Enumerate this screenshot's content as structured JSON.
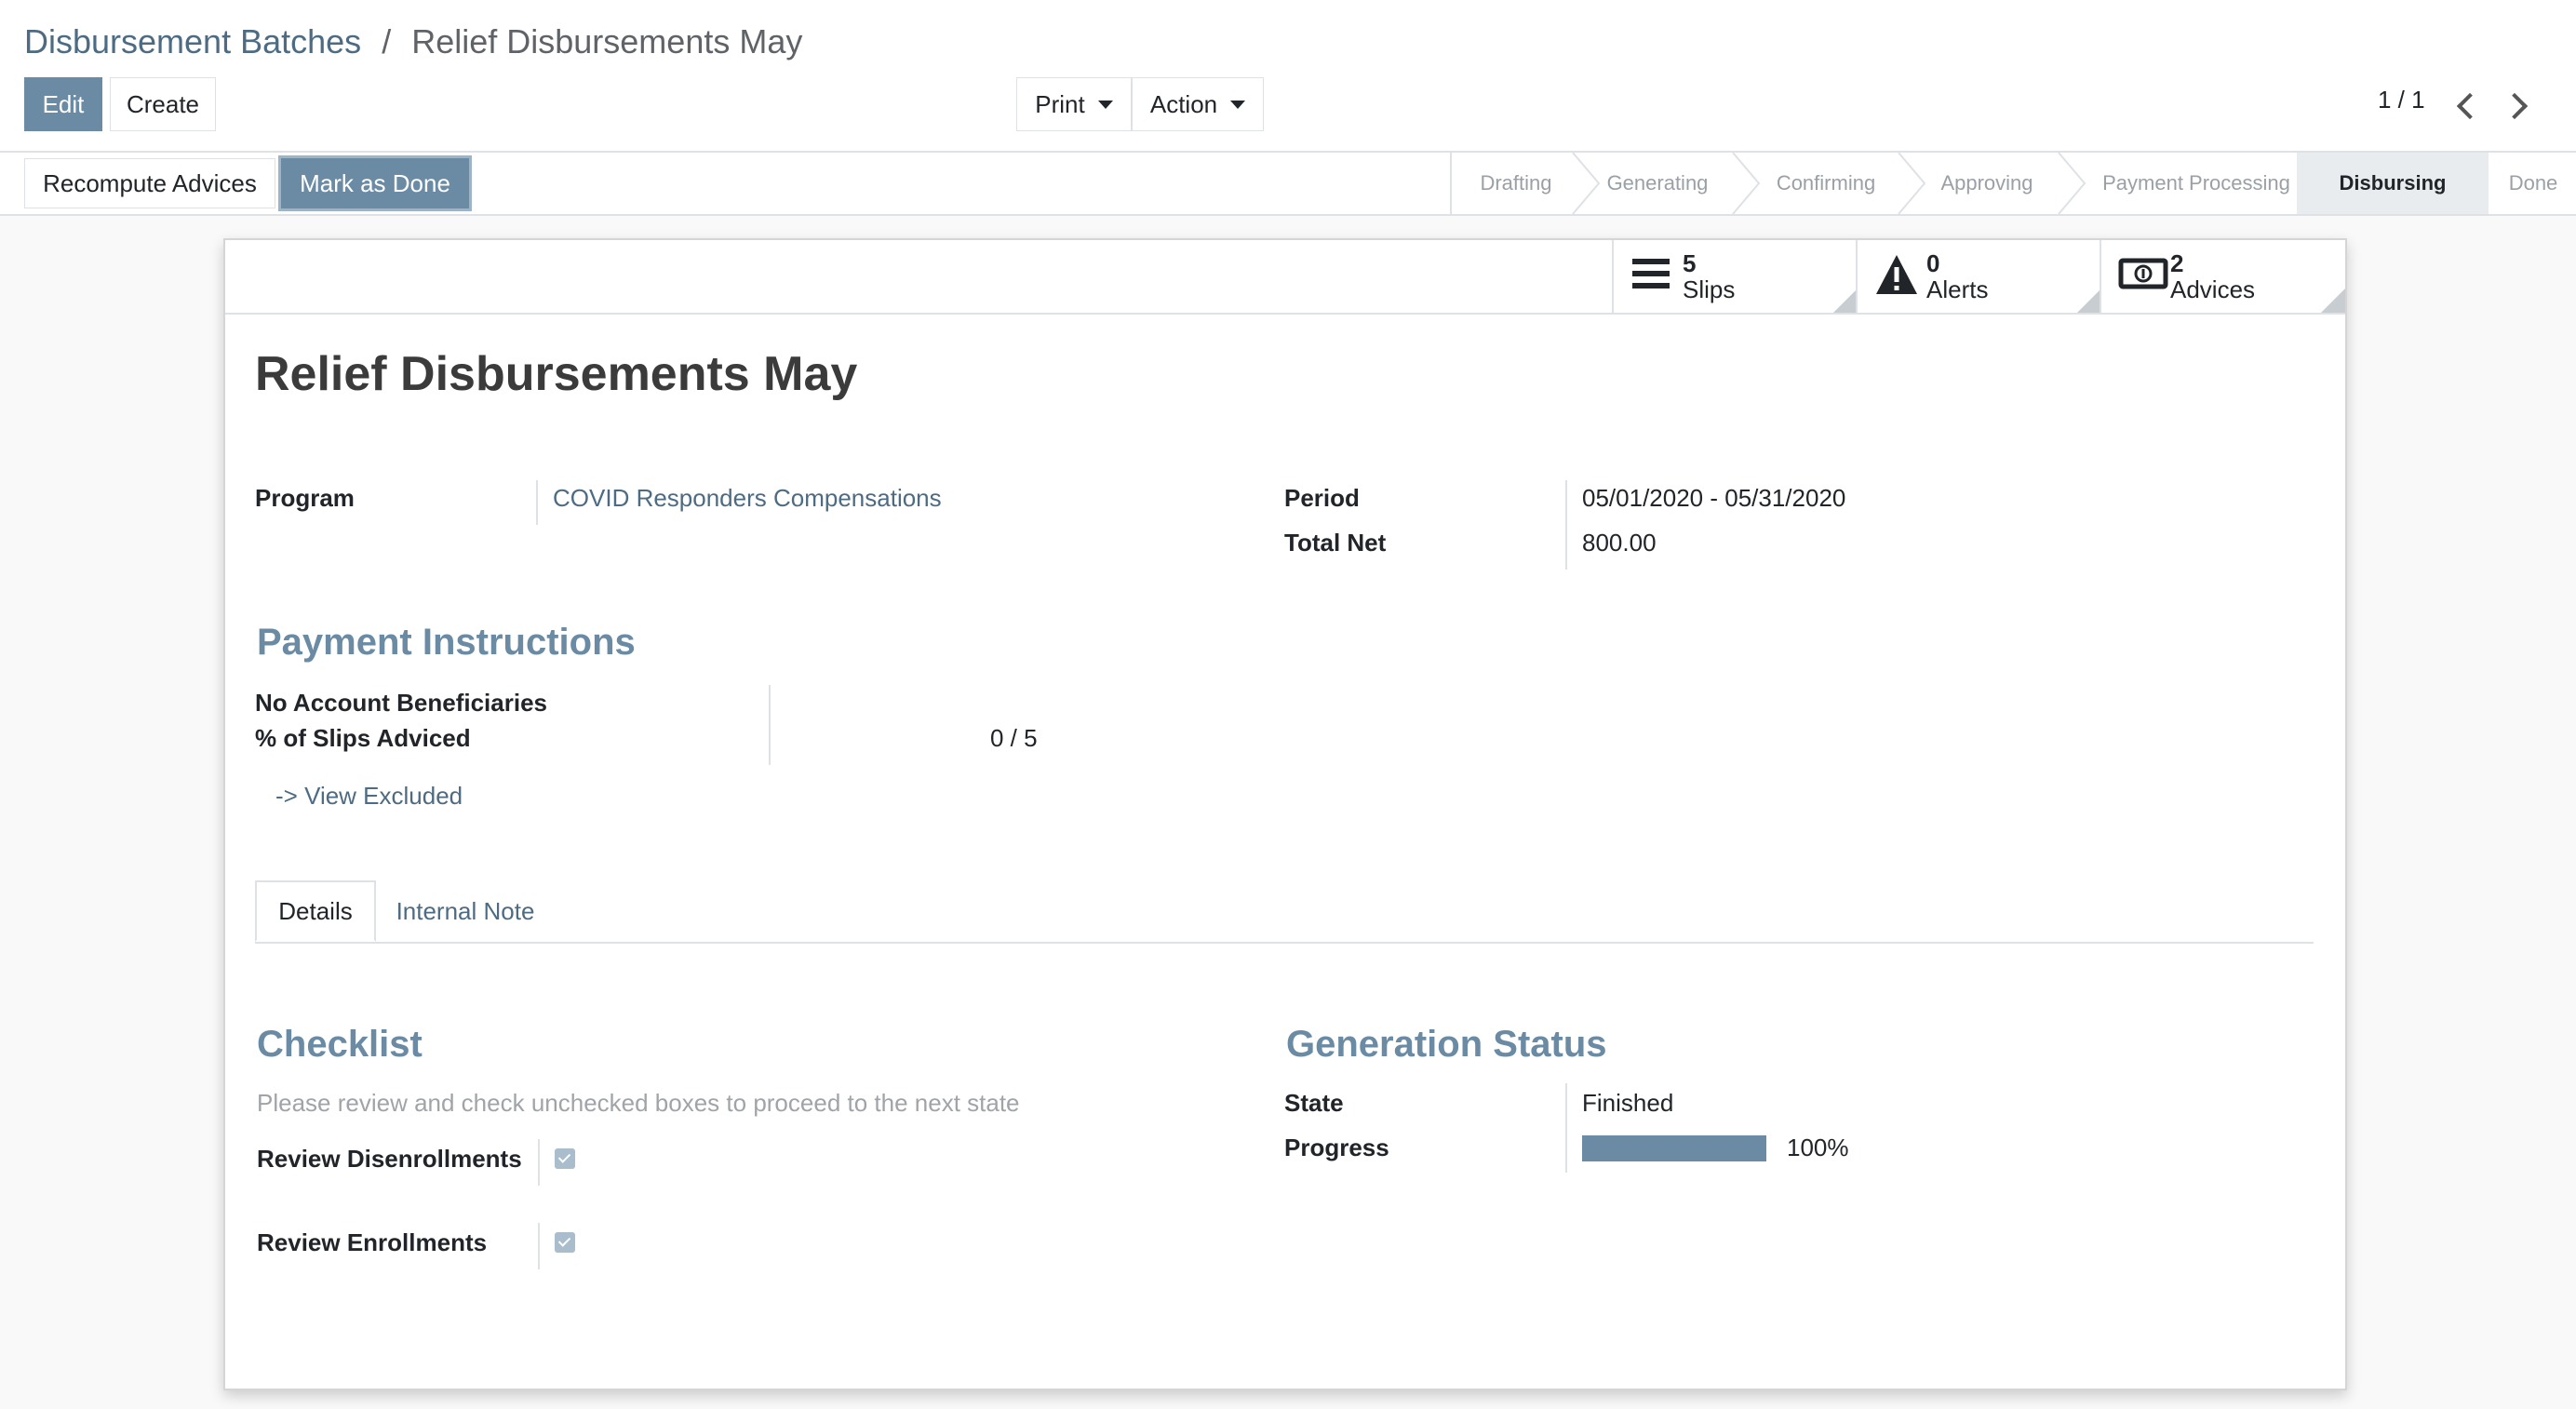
{
  "breadcrumb": {
    "parent": "Disbursement Batches",
    "separator": "/",
    "current": "Relief Disbursements May"
  },
  "toolbar": {
    "edit": "Edit",
    "create": "Create",
    "print": "Print",
    "action": "Action",
    "pager": "1 / 1"
  },
  "header_buttons": {
    "recompute": "Recompute Advices",
    "mark_done": "Mark as Done"
  },
  "stages": [
    "Drafting",
    "Generating",
    "Confirming",
    "Approving",
    "Payment Processing",
    "Disbursing",
    "Done"
  ],
  "active_stage": "Disbursing",
  "smart_buttons": [
    {
      "count": "5",
      "label": "Slips",
      "icon": "list-icon"
    },
    {
      "count": "0",
      "label": "Alerts",
      "icon": "warning-icon"
    },
    {
      "count": "2",
      "label": "Advices",
      "icon": "money-icon"
    }
  ],
  "record": {
    "title": "Relief Disbursements May",
    "program_label": "Program",
    "program_value": "COVID Responders Compensations",
    "period_label": "Period",
    "period_value": "05/01/2020 - 05/31/2020",
    "total_net_label": "Total Net",
    "total_net_value": "800.00"
  },
  "payment_instructions": {
    "heading": "Payment Instructions",
    "no_account_label": "No Account Beneficiaries",
    "slips_adviced_label": "% of Slips Adviced",
    "slips_adviced_value": "0 / 5",
    "view_excluded": "-> View Excluded"
  },
  "tabs": {
    "details": "Details",
    "internal_note": "Internal Note"
  },
  "checklist": {
    "heading": "Checklist",
    "hint": "Please review and check unchecked boxes to proceed to the next state",
    "review_disenrollments": "Review Disenrollments",
    "review_enrollments": "Review Enrollments",
    "review_disenrollments_checked": true,
    "review_enrollments_checked": true
  },
  "generation_status": {
    "heading": "Generation Status",
    "state_label": "State",
    "state_value": "Finished",
    "progress_label": "Progress",
    "progress_value": "100%",
    "progress_fraction": 1.0
  },
  "colors": {
    "primary": "#6a8ba3",
    "link": "#4d6b82"
  }
}
